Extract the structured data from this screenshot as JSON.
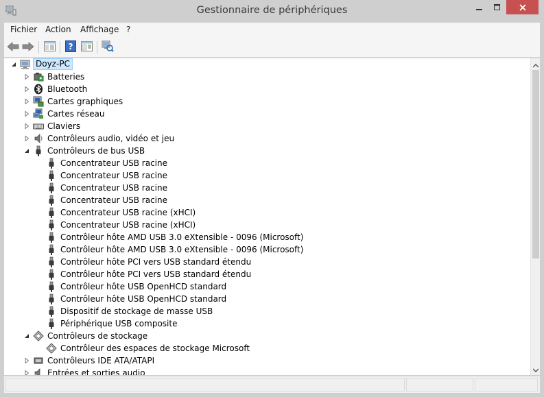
{
  "window": {
    "title": "Gestionnaire de périphériques",
    "controls": {
      "minimize": "minimize-icon",
      "maximize": "maximize-icon",
      "close": "close-icon"
    }
  },
  "menu": {
    "items": [
      {
        "label": "Fichier"
      },
      {
        "label": "Action"
      },
      {
        "label": "Affichage"
      },
      {
        "label": "?"
      }
    ]
  },
  "toolbar": {
    "buttons": [
      {
        "icon": "back-arrow-icon"
      },
      {
        "icon": "forward-arrow-icon"
      },
      {
        "icon": "console-tree-icon"
      },
      {
        "icon": "help-icon"
      },
      {
        "icon": "properties-icon"
      },
      {
        "icon": "scan-hardware-icon"
      }
    ]
  },
  "tree": {
    "root": {
      "label": "Doyz-PC",
      "icon": "computer-icon"
    },
    "nodes": [
      {
        "label": "Batteries",
        "icon": "battery-icon",
        "level": 1,
        "state": "collapsed"
      },
      {
        "label": "Bluetooth",
        "icon": "bluetooth-icon",
        "level": 1,
        "state": "collapsed"
      },
      {
        "label": "Cartes graphiques",
        "icon": "display-adapter-icon",
        "level": 1,
        "state": "collapsed"
      },
      {
        "label": "Cartes réseau",
        "icon": "network-adapter-icon",
        "level": 1,
        "state": "collapsed"
      },
      {
        "label": "Claviers",
        "icon": "keyboard-icon",
        "level": 1,
        "state": "collapsed"
      },
      {
        "label": "Contrôleurs audio, vidéo et jeu",
        "icon": "speaker-icon",
        "level": 1,
        "state": "collapsed"
      },
      {
        "label": "Contrôleurs de bus USB",
        "icon": "usb-plug-icon",
        "level": 1,
        "state": "expanded"
      },
      {
        "label": "Concentrateur USB racine",
        "icon": "usb-plug-icon",
        "level": 2,
        "state": "leaf"
      },
      {
        "label": "Concentrateur USB racine",
        "icon": "usb-plug-icon",
        "level": 2,
        "state": "leaf"
      },
      {
        "label": "Concentrateur USB racine",
        "icon": "usb-plug-icon",
        "level": 2,
        "state": "leaf"
      },
      {
        "label": "Concentrateur USB racine",
        "icon": "usb-plug-icon",
        "level": 2,
        "state": "leaf"
      },
      {
        "label": "Concentrateur USB racine (xHCI)",
        "icon": "usb-plug-icon",
        "level": 2,
        "state": "leaf"
      },
      {
        "label": "Concentrateur USB racine (xHCI)",
        "icon": "usb-plug-icon",
        "level": 2,
        "state": "leaf"
      },
      {
        "label": "Contrôleur hôte AMD USB 3.0 eXtensible - 0096 (Microsoft)",
        "icon": "usb-plug-icon",
        "level": 2,
        "state": "leaf"
      },
      {
        "label": "Contrôleur hôte AMD USB 3.0 eXtensible - 0096 (Microsoft)",
        "icon": "usb-plug-icon",
        "level": 2,
        "state": "leaf"
      },
      {
        "label": "Contrôleur hôte PCI vers USB standard étendu",
        "icon": "usb-plug-icon",
        "level": 2,
        "state": "leaf"
      },
      {
        "label": "Contrôleur hôte PCI vers USB standard étendu",
        "icon": "usb-plug-icon",
        "level": 2,
        "state": "leaf"
      },
      {
        "label": "Contrôleur hôte USB OpenHCD standard",
        "icon": "usb-plug-icon",
        "level": 2,
        "state": "leaf"
      },
      {
        "label": "Contrôleur hôte USB OpenHCD standard",
        "icon": "usb-plug-icon",
        "level": 2,
        "state": "leaf"
      },
      {
        "label": "Dispositif de stockage de masse USB",
        "icon": "usb-plug-icon",
        "level": 2,
        "state": "leaf"
      },
      {
        "label": "Périphérique USB composite",
        "icon": "usb-plug-icon",
        "level": 2,
        "state": "leaf"
      },
      {
        "label": "Contrôleurs de stockage",
        "icon": "storage-controller-icon",
        "level": 1,
        "state": "expanded"
      },
      {
        "label": "Contrôleur des espaces de stockage Microsoft",
        "icon": "storage-controller-icon",
        "level": 2,
        "state": "leaf"
      },
      {
        "label": "Contrôleurs IDE ATA/ATAPI",
        "icon": "ide-controller-icon",
        "level": 1,
        "state": "collapsed"
      },
      {
        "label": "Entrées et sorties audio",
        "icon": "audio-io-icon",
        "level": 1,
        "state": "collapsed"
      }
    ]
  },
  "scrollbar": {
    "up": "scroll-up-arrow-icon",
    "down": "scroll-down-arrow-icon"
  }
}
